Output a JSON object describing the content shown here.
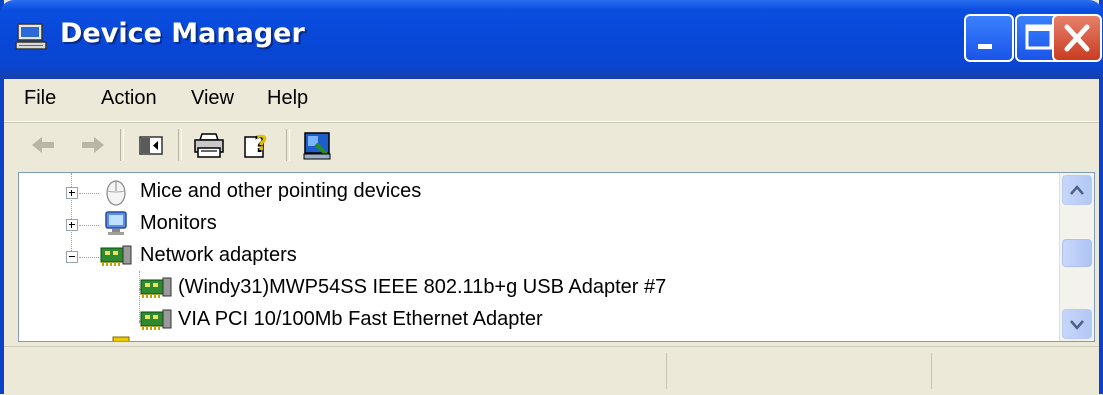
{
  "window": {
    "title": "Device Manager",
    "accent_color": "#0a4fe0",
    "controls": [
      "minimize-button",
      "maximize-button",
      "close-button"
    ]
  },
  "menubar": {
    "items": [
      {
        "label": "File"
      },
      {
        "label": "Action"
      },
      {
        "label": "View"
      },
      {
        "label": "Help"
      }
    ]
  },
  "toolbar": {
    "buttons": [
      {
        "icon": "back-arrow-icon",
        "enabled": false
      },
      {
        "icon": "forward-arrow-icon",
        "enabled": false
      },
      {
        "icon": "show-hide-console-tree-icon",
        "enabled": true
      },
      {
        "icon": "print-icon",
        "enabled": true
      },
      {
        "icon": "help-icon",
        "enabled": true
      },
      {
        "icon": "scan-hardware-changes-icon",
        "enabled": true
      }
    ]
  },
  "tree": {
    "items": [
      {
        "label": "Mice and other pointing devices",
        "icon": "mouse-icon",
        "expander": "plus"
      },
      {
        "label": "Monitors",
        "icon": "monitor-icon",
        "expander": "plus"
      },
      {
        "label": "Network adapters",
        "icon": "network-card-icon",
        "expander": "minus"
      },
      {
        "label": "(Windy31)MWP54SS IEEE 802.11b+g USB Adapter #7",
        "icon": "network-card-icon",
        "expander": "none"
      },
      {
        "label": "VIA PCI 10/100Mb Fast Ethernet Adapter",
        "icon": "network-card-icon",
        "expander": "none"
      }
    ]
  },
  "statusbar": {
    "panels": [
      "",
      "",
      ""
    ]
  }
}
